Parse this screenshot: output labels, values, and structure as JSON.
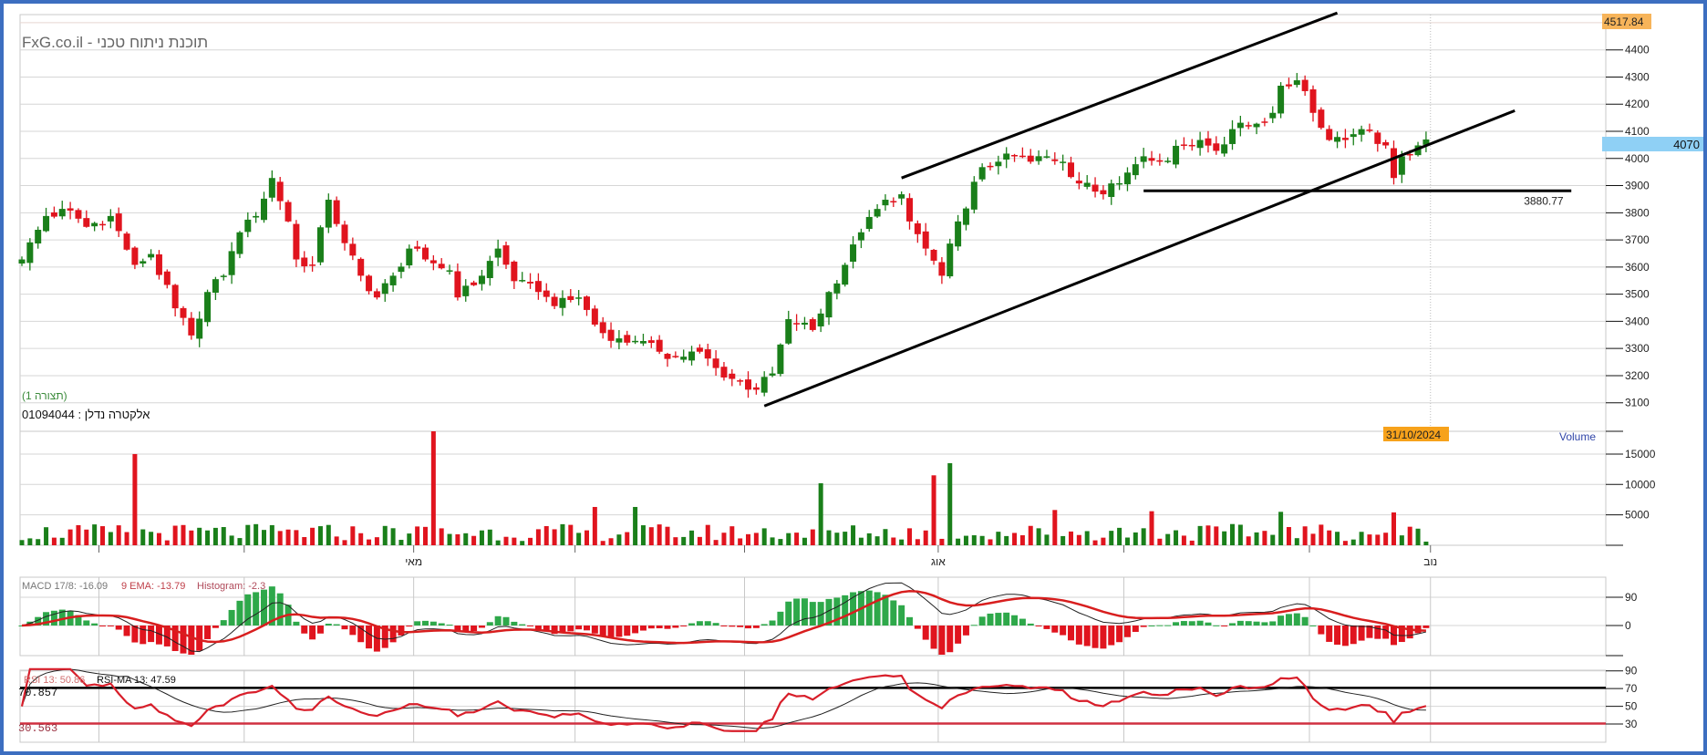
{
  "header": {
    "title": "FxG.co.il - תוכנת ניתוח טכני",
    "layout_label": "(תצורה 1)",
    "instrument": "01094044 : אלקטרה נדלן"
  },
  "badges": {
    "high_value": "4517.84",
    "last_price": "4070",
    "cursor_date": "31/10/2024",
    "hline_label": "3880.77"
  },
  "colors": {
    "up": "#1a7f1a",
    "down": "#e0141e",
    "macd_up": "#2ea84a",
    "accent_orange": "#f7a21b",
    "last_blue": "#8fd0f5",
    "frame": "#3c6ec0"
  },
  "chart_data": [
    {
      "type": "candlestick",
      "title": "FxG.co.il - תוכנת ניתוח טכני",
      "ylim": [
        3050,
        4520
      ],
      "yticks": [
        "3100",
        "3200",
        "3300",
        "3400",
        "3500",
        "3600",
        "3700",
        "3800",
        "3900",
        "4000",
        "4100",
        "4200",
        "4300",
        "4400"
      ],
      "x_months": [
        {
          "day": 49,
          "label": "מאי"
        },
        {
          "day": 114,
          "label": "אוג"
        },
        {
          "day": 175,
          "label": "נוב"
        }
      ],
      "n_days": 175,
      "close_keypoints": [
        [
          0,
          3628
        ],
        [
          3,
          3788
        ],
        [
          6,
          3808
        ],
        [
          8,
          3748
        ],
        [
          11,
          3788
        ],
        [
          14,
          3608
        ],
        [
          16,
          3648
        ],
        [
          19,
          3448
        ],
        [
          21,
          3348
        ],
        [
          23,
          3508
        ],
        [
          25,
          3568
        ],
        [
          27,
          3728
        ],
        [
          29,
          3788
        ],
        [
          31,
          3928
        ],
        [
          33,
          3768
        ],
        [
          34,
          3628
        ],
        [
          36,
          3608
        ],
        [
          38,
          3848
        ],
        [
          40,
          3688
        ],
        [
          42,
          3568
        ],
        [
          44,
          3488
        ],
        [
          46,
          3568
        ],
        [
          48,
          3668
        ],
        [
          50,
          3628
        ],
        [
          53,
          3588
        ],
        [
          54,
          3488
        ],
        [
          57,
          3568
        ],
        [
          59,
          3668
        ],
        [
          61,
          3548
        ],
        [
          64,
          3508
        ],
        [
          66,
          3456
        ],
        [
          69,
          3488
        ],
        [
          71,
          3388
        ],
        [
          73,
          3328
        ],
        [
          76,
          3328
        ],
        [
          79,
          3288
        ],
        [
          81,
          3268
        ],
        [
          84,
          3288
        ],
        [
          86,
          3228
        ],
        [
          88,
          3188
        ],
        [
          91,
          3148
        ],
        [
          93,
          3208
        ],
        [
          95,
          3408
        ],
        [
          98,
          3368
        ],
        [
          100,
          3508
        ],
        [
          102,
          3608
        ],
        [
          104,
          3728
        ],
        [
          107,
          3848
        ],
        [
          109,
          3868
        ],
        [
          110,
          3768
        ],
        [
          112,
          3668
        ],
        [
          114,
          3568
        ],
        [
          116,
          3768
        ],
        [
          119,
          3968
        ],
        [
          121,
          3988
        ],
        [
          123,
          4008
        ],
        [
          125,
          3988
        ],
        [
          127,
          4008
        ],
        [
          129,
          3988
        ],
        [
          131,
          3908
        ],
        [
          134,
          3868
        ],
        [
          135,
          3908
        ],
        [
          137,
          3948
        ],
        [
          139,
          4008
        ],
        [
          141,
          3988
        ],
        [
          144,
          4048
        ],
        [
          146,
          4068
        ],
        [
          148,
          4028
        ],
        [
          150,
          4108
        ],
        [
          153,
          4128
        ],
        [
          155,
          4168
        ],
        [
          156,
          4268
        ],
        [
          158,
          4288
        ],
        [
          159,
          4248
        ],
        [
          160,
          4168
        ],
        [
          162,
          4068
        ],
        [
          164,
          4068
        ],
        [
          166,
          4108
        ],
        [
          169,
          4048
        ],
        [
          170,
          3928
        ],
        [
          171,
          4008
        ],
        [
          173,
          4048
        ],
        [
          174,
          4070
        ]
      ],
      "annotations": {
        "upper_channel": [
          [
            109,
            3928
          ],
          [
            163,
            4536
          ]
        ],
        "lower_trend": [
          [
            92,
            3088
          ],
          [
            185,
            4176
          ]
        ],
        "hline": {
          "value": 3880.77,
          "from_day": 139,
          "to_day": 192
        }
      }
    },
    {
      "type": "bar",
      "title": "Volume",
      "yticks": [
        "5000",
        "10000",
        "15000"
      ],
      "ylim": [
        0,
        19000
      ],
      "spikes": [
        [
          14,
          15000
        ],
        [
          51,
          19000
        ],
        [
          71,
          6300
        ],
        [
          76,
          6300
        ],
        [
          99,
          10200
        ],
        [
          113,
          11500
        ],
        [
          115,
          13500
        ],
        [
          128,
          5800
        ],
        [
          140,
          5600
        ],
        [
          156,
          5500
        ],
        [
          170,
          5400
        ]
      ]
    },
    {
      "type": "line",
      "title": "MACD",
      "labels": {
        "macd": "MACD 17/8: -16.09",
        "ema": "9 EMA:  -13.79",
        "hist": "Histogram: -2.3"
      },
      "yticks": [
        "90",
        "0"
      ]
    },
    {
      "type": "line",
      "title": "RSI",
      "labels": {
        "rsi": "RSI 13: 50.86",
        "ma": "RSI-MA 13: 47.59",
        "upper": "70.857",
        "lower": "30.563"
      },
      "upper_level": 70.857,
      "lower_level": 30.563,
      "yticks": [
        "90",
        "70",
        "50",
        "30"
      ]
    }
  ]
}
